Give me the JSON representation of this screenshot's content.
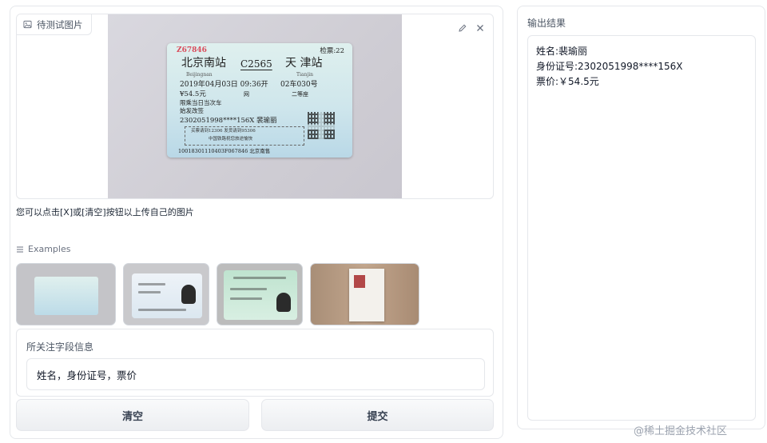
{
  "input_image": {
    "label": "待测试图片",
    "ticket": {
      "serial": "Z67846",
      "check": "检票:22",
      "from": "北京南站",
      "from_pinyin": "Beijingnan",
      "train": "C2565",
      "to": "天 津站",
      "to_pinyin": "Tianjin",
      "date": "2019年04月03日 09:36开",
      "seat": "02车030号",
      "price": "¥54.5元",
      "net": "网",
      "class": "二等座",
      "note1": "限乘当日当次车",
      "note2": "始发改签",
      "id_name": "2302051998****156X 裴瑜丽",
      "box_line1": "买票请到12306 发货请到95306",
      "box_line2": "中国铁路祝您旅途愉快",
      "code": "10018301110403F067846 北京南售"
    }
  },
  "hint": "您可以点击[X]或[清空]按钮以上传自己的图片",
  "examples": {
    "label": "Examples"
  },
  "fields": {
    "label": "所关注字段信息",
    "value": "姓名，身份证号，票价"
  },
  "buttons": {
    "clear": "清空",
    "submit": "提交"
  },
  "output": {
    "label": "输出结果",
    "lines": [
      "姓名:裴瑜丽",
      "身份证号:2302051998****156X",
      "票价:￥54.5元"
    ]
  },
  "watermark": "@稀土掘金技术社区"
}
